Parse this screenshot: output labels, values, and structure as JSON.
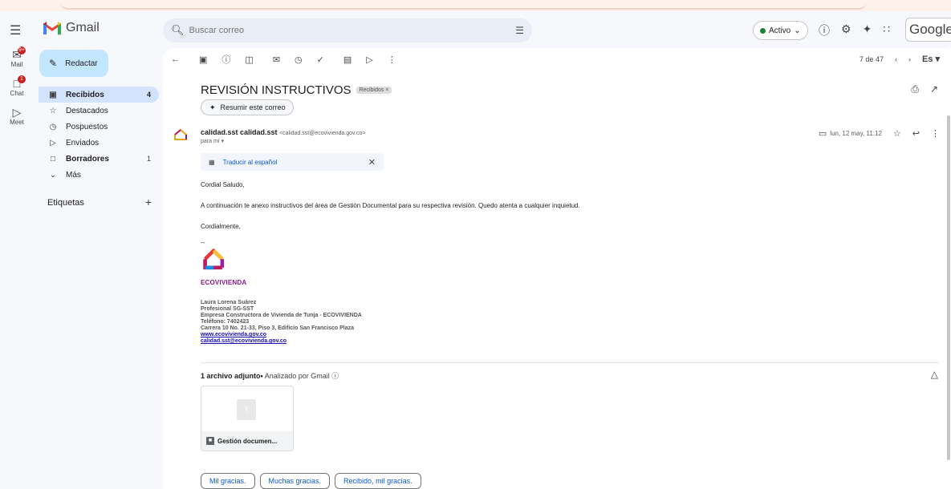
{
  "topbar": {
    "app_name": "Gmail",
    "search_placeholder": "Buscar correo",
    "status": "Activo",
    "google_word": "Google"
  },
  "rail": {
    "items": [
      {
        "label": "Mail",
        "badge": "9+"
      },
      {
        "label": "Chat",
        "badge": "1"
      },
      {
        "label": "Meet",
        "badge": ""
      }
    ]
  },
  "sidebar": {
    "compose_label": "Redactar",
    "items": [
      {
        "label": "Recibidos",
        "count": "4",
        "icon": "inbox-icon"
      },
      {
        "label": "Destacados",
        "count": "",
        "icon": "star-icon"
      },
      {
        "label": "Pospuestos",
        "count": "",
        "icon": "clock-icon"
      },
      {
        "label": "Enviados",
        "count": "",
        "icon": "send-icon"
      },
      {
        "label": "Borradores",
        "count": "1",
        "icon": "draft-icon"
      },
      {
        "label": "Más",
        "count": "",
        "icon": "chevron-down-icon"
      }
    ],
    "labels_title": "Etiquetas"
  },
  "toolbar": {
    "pager_text": "7 de 47",
    "lang": "Es"
  },
  "email": {
    "subject": "REVISIÓN INSTRUCTIVOS",
    "subject_tag": "Recibidos ×",
    "summary_label": "Resumir este correo",
    "sender_name": "calidad.sst calidad.sst",
    "sender_email": "<calidad.sst@ecovivienda.gov.co>",
    "to_label": "para mí",
    "date": "lun, 12 may, 11:12",
    "translate_label": "Traducir al español",
    "greeting": "Cordial Saludo,",
    "body": "A continuación te anexo instructivos del área de Gestión Documental para su respectiva revisión. Quedo atenta a cualquier inquietud.",
    "closing": "Cordialmente,",
    "dash": "--",
    "signature": {
      "brand": "ECOVIVIENDA",
      "name": "Laura Lorena Suárez",
      "role": "Profesional SG-SST",
      "company": "Empresa Constructora de Vivienda de Tunja - ECOVIVIENDA",
      "phone": "Teléfono: 7402423",
      "address": "Carrera 10 No. 21-33, Piso 3, Edificio San Francisco Plaza",
      "web": "www.ecovivienda.gov.co",
      "email": "calidad.sst@ecovivienda.gov.co"
    },
    "attachments_count_label": "1 archivo adjunto",
    "attachments_scan_label": "Analizado por Gmail",
    "attachment_name": "Gestión documen...",
    "smart_replies": [
      "Mil gracias.",
      "Muchas gracias.",
      "Recibido, mil gracias."
    ]
  },
  "colors": {
    "background": "#f6f8fc",
    "compose": "#c2e7ff",
    "active_nav": "#d3e3fd",
    "link": "#0b57d0",
    "brand_purple": "#8b1a89"
  }
}
